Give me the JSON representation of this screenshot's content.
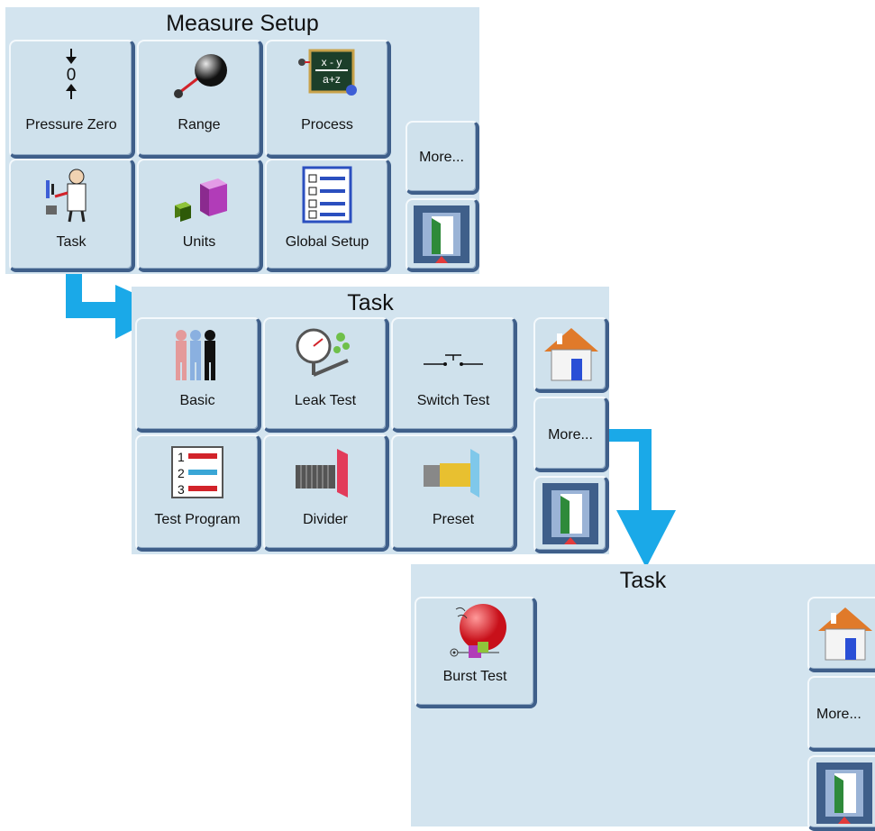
{
  "screens": [
    {
      "title": "Measure Setup",
      "buttons": {
        "pressure_zero": "Pressure Zero",
        "zero_digit": "0",
        "range": "Range",
        "process": "Process",
        "process_formula_top": "x - y",
        "process_formula_bottom": "a+z",
        "task": "Task",
        "units": "Units",
        "global_setup": "Global Setup"
      },
      "side": {
        "more": "More..."
      }
    },
    {
      "title": "Task",
      "buttons": {
        "basic": "Basic",
        "leak_test": "Leak Test",
        "switch_test": "Switch Test",
        "test_program": "Test Program",
        "program_steps": [
          "1",
          "2",
          "3"
        ],
        "divider": "Divider",
        "preset": "Preset"
      },
      "side": {
        "more": "More..."
      }
    },
    {
      "title": "Task",
      "buttons": {
        "burst_test": "Burst Test"
      },
      "side": {
        "more": "More..."
      }
    }
  ],
  "colors": {
    "panel_bg": "#d3e4ef",
    "button_border": "#3f5f8a",
    "flow_arrow": "#1aa9e8"
  },
  "icons": [
    "zero-arrows-icon",
    "range-ball-icon",
    "process-formula-icon",
    "technician-icon",
    "units-cubes-icon",
    "checklist-icon",
    "exit-door-icon",
    "home-icon",
    "people-icon",
    "gauge-icon",
    "switch-icon",
    "numbered-list-icon",
    "divider-icon",
    "preset-icon",
    "burst-balloon-icon"
  ]
}
